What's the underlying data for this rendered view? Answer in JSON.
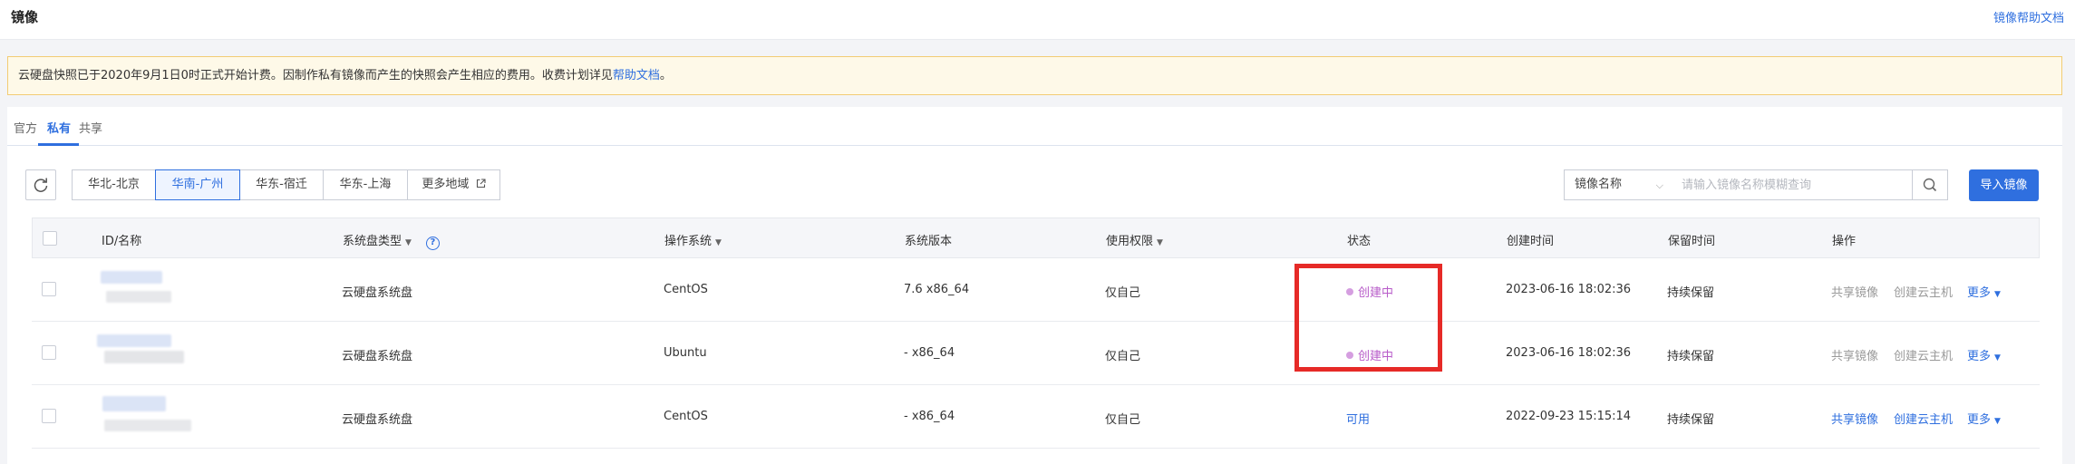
{
  "header": {
    "title": "镜像",
    "help_link": "镜像帮助文档"
  },
  "notice": {
    "text": "云硬盘快照已于2020年9月1日0时正式开始计费。因制作私有镜像而产生的快照会产生相应的费用。收费计划详见",
    "link": "帮助文档",
    "suffix": "。"
  },
  "tabs": [
    {
      "label": "官方",
      "active": false
    },
    {
      "label": "私有",
      "active": true
    },
    {
      "label": "共享",
      "active": false
    }
  ],
  "toolbar": {
    "refresh_icon": "refresh-icon",
    "regions": [
      {
        "label": "华北-北京",
        "active": false
      },
      {
        "label": "华南-广州",
        "active": true
      },
      {
        "label": "华东-宿迁",
        "active": false
      },
      {
        "label": "华东-上海",
        "active": false
      },
      {
        "label": "更多地域",
        "active": false,
        "external_icon": "external-link-icon"
      }
    ],
    "search_field": "镜像名称",
    "search_placeholder": "请输入镜像名称模糊查询",
    "import_label": "导入镜像"
  },
  "table": {
    "columns": {
      "id_name": "ID/名称",
      "disk_type": "系统盘类型",
      "os": "操作系统",
      "os_version": "系统版本",
      "permission": "使用权限",
      "status": "状态",
      "created": "创建时间",
      "retention": "保留时间",
      "actions": "操作"
    },
    "rows": [
      {
        "disk_type": "云硬盘系统盘",
        "os": "CentOS",
        "os_version": "7.6 x86_64",
        "permission": "仅自己",
        "status": "创建中",
        "created": "2023-06-16 18:02:36",
        "retention": "持续保留",
        "share": "共享镜像",
        "create_host": "创建云主机",
        "more": "更多"
      },
      {
        "disk_type": "云硬盘系统盘",
        "os": "Ubuntu",
        "os_version": "- x86_64",
        "permission": "仅自己",
        "status": "创建中",
        "created": "2023-06-16 18:02:36",
        "retention": "持续保留",
        "share": "共享镜像",
        "create_host": "创建云主机",
        "more": "更多"
      },
      {
        "disk_type": "云硬盘系统盘",
        "os": "CentOS",
        "os_version": "- x86_64",
        "permission": "仅自己",
        "status": "可用",
        "created": "2022-09-23 15:15:14",
        "retention": "持续保留",
        "share": "共享镜像",
        "create_host": "创建云主机",
        "more": "更多"
      }
    ]
  },
  "colors": {
    "accent": "#2f6fdf",
    "status_creating": "#b85cc9",
    "status_available": "#2f6fdf",
    "highlight": "#e62a27"
  }
}
